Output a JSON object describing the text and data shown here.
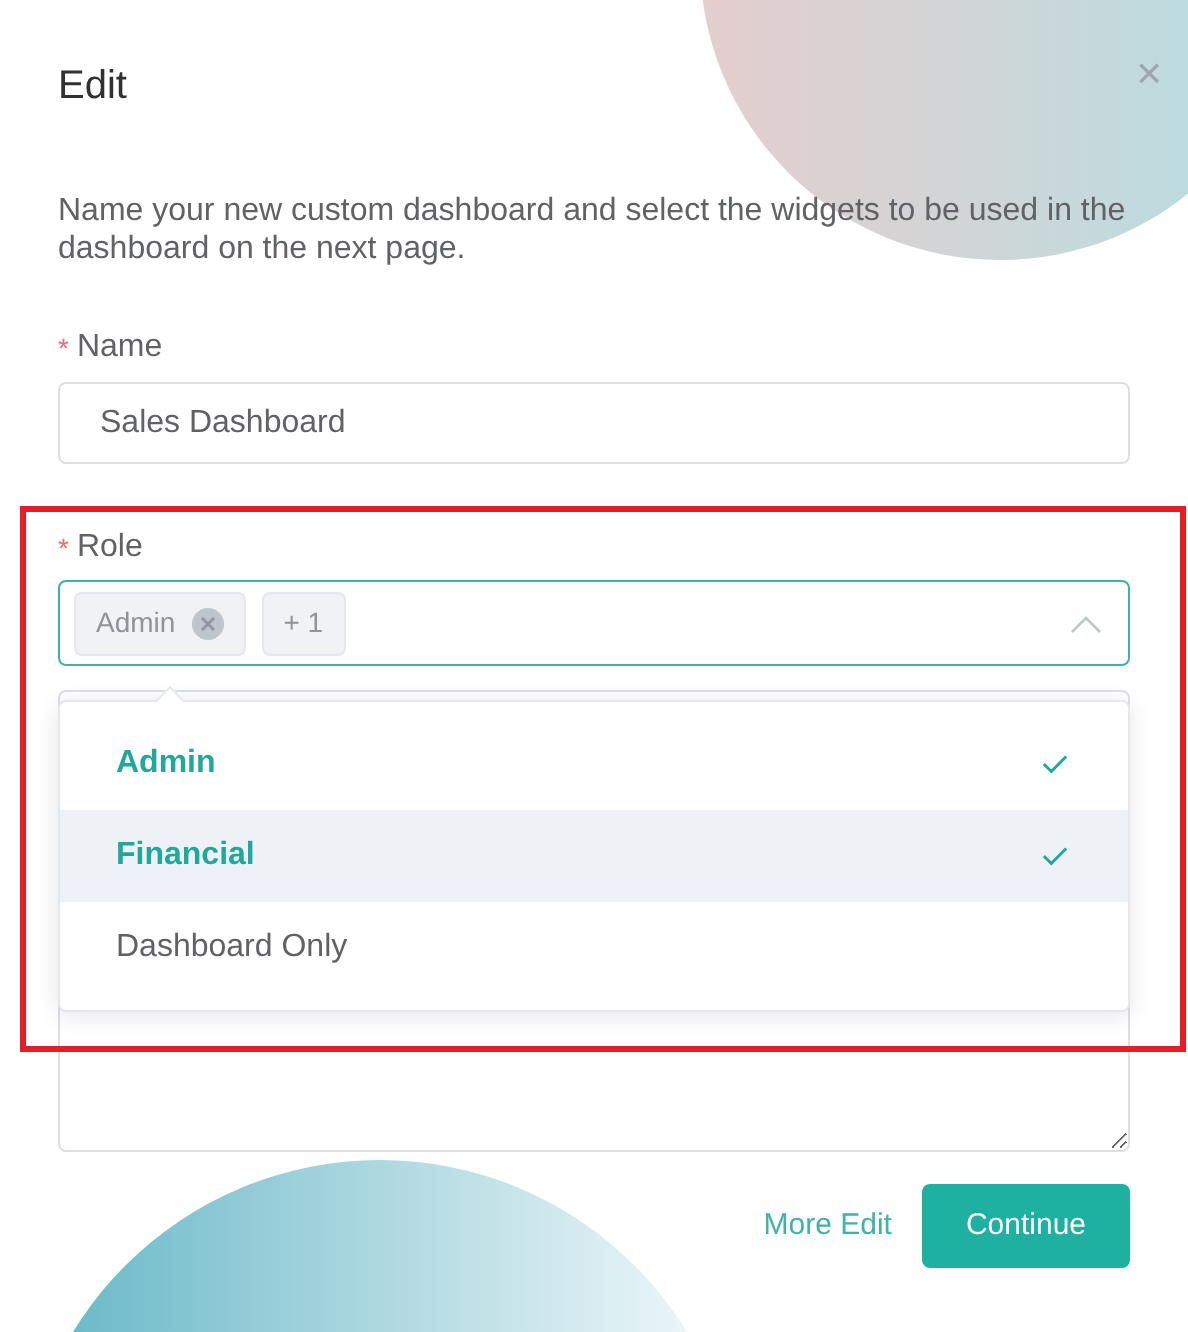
{
  "dialog": {
    "title": "Edit",
    "close": "×",
    "description": "Name your new custom dashboard and select the widgets to be used in the dashboard on the next page."
  },
  "fields": [
    {
      "label": "Name",
      "required_mark": "*",
      "value": "Sales Dashboard"
    }
  ],
  "role": {
    "label": "Role",
    "required_mark": "*",
    "tags": [
      {
        "text": "Admin",
        "removable": true
      },
      {
        "text": "+ 1",
        "removable": false
      }
    ],
    "expanded": true,
    "options": [
      {
        "label": "Admin",
        "selected": true,
        "hovered": false
      },
      {
        "label": "Financial",
        "selected": true,
        "hovered": true
      },
      {
        "label": "Dashboard Only",
        "selected": false,
        "hovered": false
      }
    ]
  },
  "highlight": {
    "shown": true
  },
  "buttons": [
    {
      "label": "More Edit",
      "kind": "link"
    },
    {
      "label": "Continue",
      "kind": "primary"
    }
  ]
}
